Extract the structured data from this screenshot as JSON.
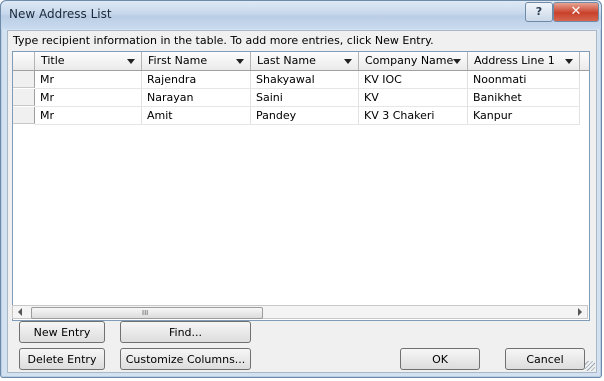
{
  "window": {
    "title": "New Address List",
    "help_label": "?",
    "close_label": "✕"
  },
  "instruction": "Type recipient information in the table.  To add more entries, click New Entry.",
  "table": {
    "columns": [
      "Title",
      "First Name",
      "Last Name",
      "Company Name",
      "Address Line 1"
    ],
    "rows": [
      [
        "Mr",
        "Rajendra",
        "Shakyawal",
        "KV IOC",
        "Noonmati"
      ],
      [
        "Mr",
        "Narayan",
        "Saini",
        "KV",
        "Banikhet"
      ],
      [
        "Mr",
        "Amit",
        "Pandey",
        "KV 3 Chakeri",
        "Kanpur"
      ]
    ]
  },
  "scrollbar": {
    "grip_label": "III"
  },
  "buttons": {
    "new_entry": "New Entry",
    "find": "Find...",
    "delete_entry": "Delete Entry",
    "customize_columns": "Customize Columns...",
    "ok": "OK",
    "cancel": "Cancel"
  }
}
